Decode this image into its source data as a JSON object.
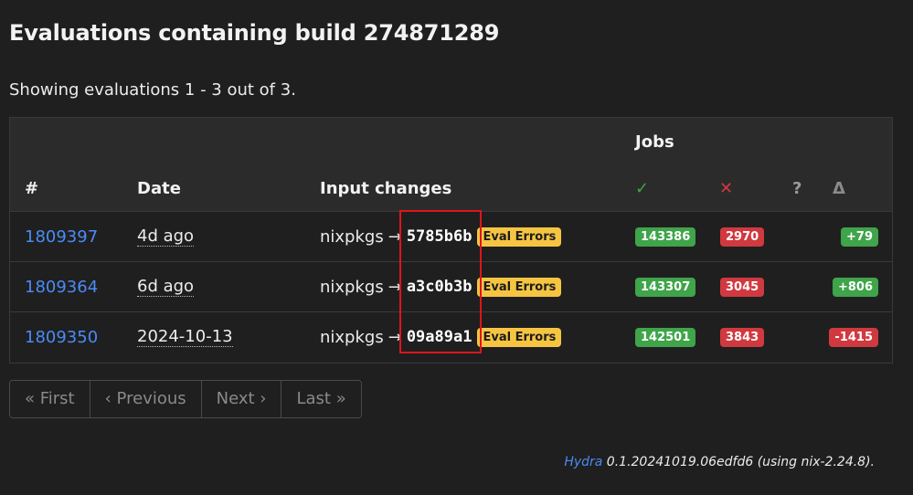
{
  "page": {
    "title": "Evaluations containing build 274871289",
    "showing": "Showing evaluations 1 - 3 out of 3."
  },
  "table": {
    "headers": {
      "jobs": "Jobs",
      "id": "#",
      "date": "Date",
      "input_changes": "Input changes",
      "succeeded": "✓",
      "failed": "✕",
      "queued": "?",
      "delta": "Δ"
    },
    "rows": [
      {
        "id": "1809397",
        "date": "4d ago",
        "input": "nixpkgs",
        "arrow": "→",
        "commit": "5785b6b",
        "badge": "Eval Errors",
        "succeeded": "143386",
        "failed": "2970",
        "delta": "+79",
        "delta_status": "positive"
      },
      {
        "id": "1809364",
        "date": "6d ago",
        "input": "nixpkgs",
        "arrow": "→",
        "commit": "a3c0b3b",
        "badge": "Eval Errors",
        "succeeded": "143307",
        "failed": "3045",
        "delta": "+806",
        "delta_status": "positive"
      },
      {
        "id": "1809350",
        "date": "2024-10-13",
        "input": "nixpkgs",
        "arrow": "→",
        "commit": "09a89a1",
        "badge": "Eval Errors",
        "succeeded": "142501",
        "failed": "3843",
        "delta": "-1415",
        "delta_status": "negative"
      }
    ]
  },
  "pagination": {
    "first": "« First",
    "previous": "‹ Previous",
    "next": "Next ›",
    "last": "Last »"
  },
  "footer": {
    "link": "Hydra",
    "text": " 0.1.20241019.06edfd6 (using nix-2.24.8)."
  },
  "colors": {
    "background": "#1f1f1f",
    "header_bg": "#2b2b2b",
    "link": "#4b8bf5",
    "success": "#3fa44a",
    "error": "#d0393f",
    "warning": "#f5c542",
    "highlight": "#e0141a"
  }
}
